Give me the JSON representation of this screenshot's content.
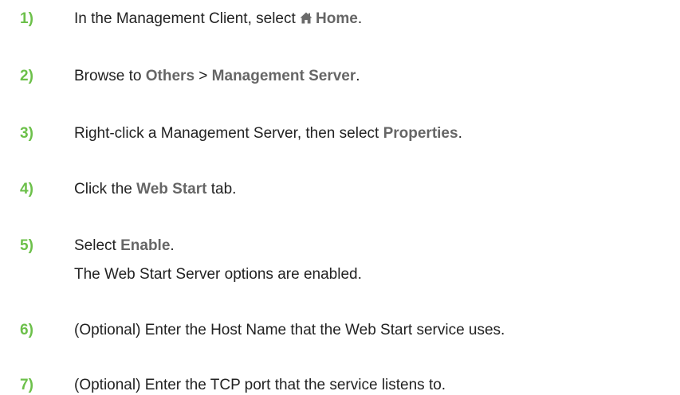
{
  "steps": [
    {
      "number": "1)",
      "text_before": "In the Management Client, select ",
      "ui_label": "Home",
      "text_after": ".",
      "icon": "home-icon"
    },
    {
      "number": "2)",
      "text_before": "Browse to ",
      "ui_label_1": "Others",
      "separator": " > ",
      "ui_label_2": "Management Server",
      "text_after": "."
    },
    {
      "number": "3)",
      "text_before": "Right-click a Management Server, then select ",
      "ui_label": "Properties",
      "text_after": "."
    },
    {
      "number": "4)",
      "text_before": "Click the ",
      "ui_label": "Web Start",
      "text_after": " tab."
    },
    {
      "number": "5)",
      "text_before": "Select ",
      "ui_label": "Enable",
      "text_after": ".",
      "result": "The Web Start Server options are enabled."
    },
    {
      "number": "6)",
      "text": "(Optional) Enter the Host Name that the Web Start service uses."
    },
    {
      "number": "7)",
      "text": "(Optional) Enter the TCP port that the service listens to."
    }
  ],
  "colors": {
    "step_number": "#6cc04a",
    "ui_label": "#666666",
    "body_text": "#222222"
  }
}
